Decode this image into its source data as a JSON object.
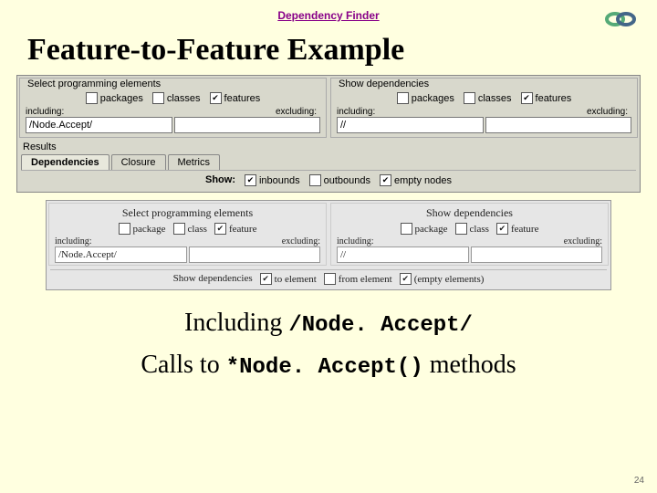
{
  "header": {
    "link": "Dependency Finder"
  },
  "title": "Feature-to-Feature Example",
  "panel1": {
    "left": {
      "caption": "Select programming elements",
      "chk_packages": "packages",
      "chk_classes": "classes",
      "chk_features": "features",
      "lbl_including": "including:",
      "lbl_excluding": "excluding:",
      "val_including": "/Node.Accept/",
      "val_excluding": ""
    },
    "right": {
      "caption": "Show dependencies",
      "chk_packages": "packages",
      "chk_classes": "classes",
      "chk_features": "features",
      "lbl_including": "including:",
      "lbl_excluding": "excluding:",
      "val_including": "//",
      "val_excluding": ""
    },
    "results": "Results",
    "tab1": "Dependencies",
    "tab2": "Closure",
    "tab3": "Metrics",
    "show_label": "Show:",
    "show_inbounds": "inbounds",
    "show_outbounds": "outbounds",
    "show_empty": "empty nodes"
  },
  "panel2": {
    "left": {
      "caption": "Select programming elements",
      "chk_packages": "package",
      "chk_classes": "class",
      "chk_features": "feature",
      "lbl_including": "including:",
      "lbl_excluding": "excluding:",
      "val_including": "/Node.Accept/"
    },
    "right": {
      "caption": "Show dependencies",
      "chk_packages": "package",
      "chk_classes": "class",
      "chk_features": "feature",
      "lbl_including": "including:",
      "lbl_excluding": "excluding:",
      "val_including": "//"
    },
    "show_label": "Show dependencies",
    "show_to": "to element",
    "show_from": "from element",
    "show_empty": "(empty elements)"
  },
  "bottom": {
    "line1_pre": "Including ",
    "line1_code": "/Node. Accept/",
    "line2_pre": "Calls to ",
    "line2_code": "*Node. Accept()",
    "line2_post": " methods"
  },
  "pagenum": "24"
}
